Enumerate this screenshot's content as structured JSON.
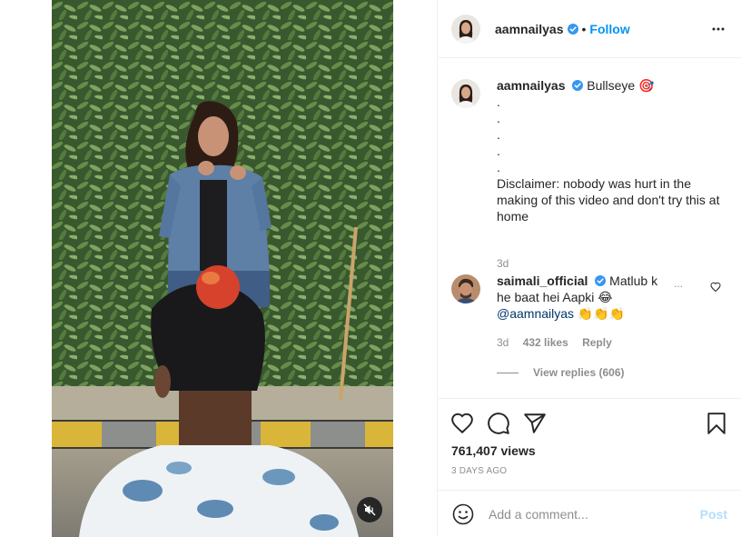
{
  "post": {
    "author": "aamnailyas",
    "follow_label": "Follow",
    "separator": "•"
  },
  "caption": {
    "username": "aamnailyas",
    "title": "Bullseye",
    "emoji": "🎯",
    "dots": [
      ".",
      ".",
      ".",
      ".",
      "."
    ],
    "body": "Disclaimer: nobody was hurt in the making of this video and don't try this at home",
    "time": "3d"
  },
  "comment": {
    "username": "saimali_official",
    "text_line1": "Matlub k",
    "text_line2": "he baat hei Aapki 😂",
    "mention": "@aamnailyas",
    "clap_emojis": "👏👏👏",
    "overflow": "...",
    "time": "3d",
    "likes": "432 likes",
    "reply_label": "Reply",
    "view_replies": "View replies (606)"
  },
  "stats": {
    "views": "761,407 views",
    "date": "3 DAYS AGO"
  },
  "add_comment": {
    "placeholder": "Add a comment...",
    "post_label": "Post"
  },
  "icons": {
    "verified": "verified-badge-icon",
    "more": "more-options-icon",
    "like": "heart-icon",
    "comment": "comment-icon",
    "share": "paper-plane-icon",
    "save": "bookmark-icon",
    "emoji": "emoji-icon",
    "mute": "muted-speaker-icon"
  },
  "colors": {
    "accent": "#0095f6",
    "verified": "#3897f0",
    "post_disabled": "#b2dffc",
    "muted_text": "#8e8e8e"
  }
}
